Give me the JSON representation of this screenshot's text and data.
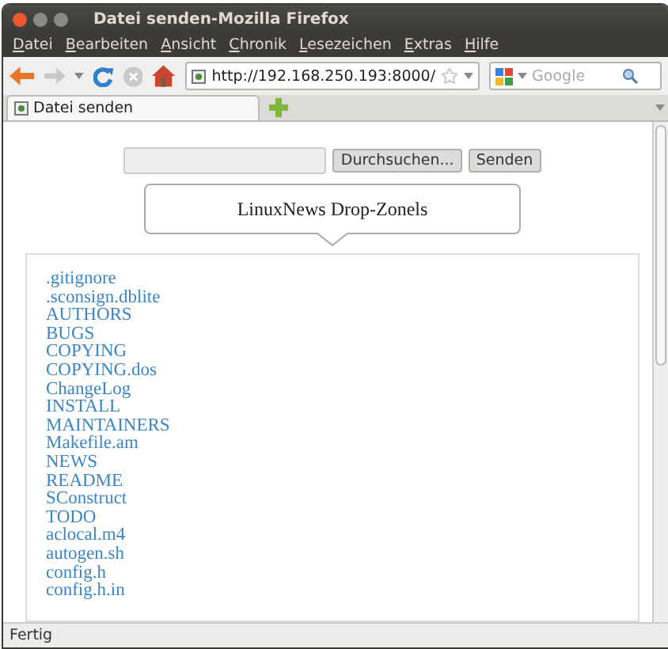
{
  "window": {
    "title": "Datei senden-Mozilla Firefox"
  },
  "menu": [
    "Datei",
    "Bearbeiten",
    "Ansicht",
    "Chronik",
    "Lesezeichen",
    "Extras",
    "Hilfe"
  ],
  "toolbar": {
    "url": "http://192.168.250.193:8000/",
    "search_placeholder": "Google"
  },
  "tabs": [
    {
      "label": "Datei senden",
      "selected": true
    }
  ],
  "upload": {
    "browse_button": "Durchsuchen...",
    "send_button": "Senden"
  },
  "drop_zone": {
    "title": "LinuxNews Drop-Zonels"
  },
  "files": [
    ".gitignore",
    ".sconsign.dblite",
    "AUTHORS",
    "BUGS",
    "COPYING",
    "COPYING.dos",
    "ChangeLog",
    "INSTALL",
    "MAINTAINERS",
    "Makefile.am",
    "NEWS",
    "README",
    "SConstruct",
    "TODO",
    "aclocal.m4",
    "autogen.sh",
    "config.h",
    "config.h.in"
  ],
  "status_bar": {
    "text": "Fertig"
  }
}
